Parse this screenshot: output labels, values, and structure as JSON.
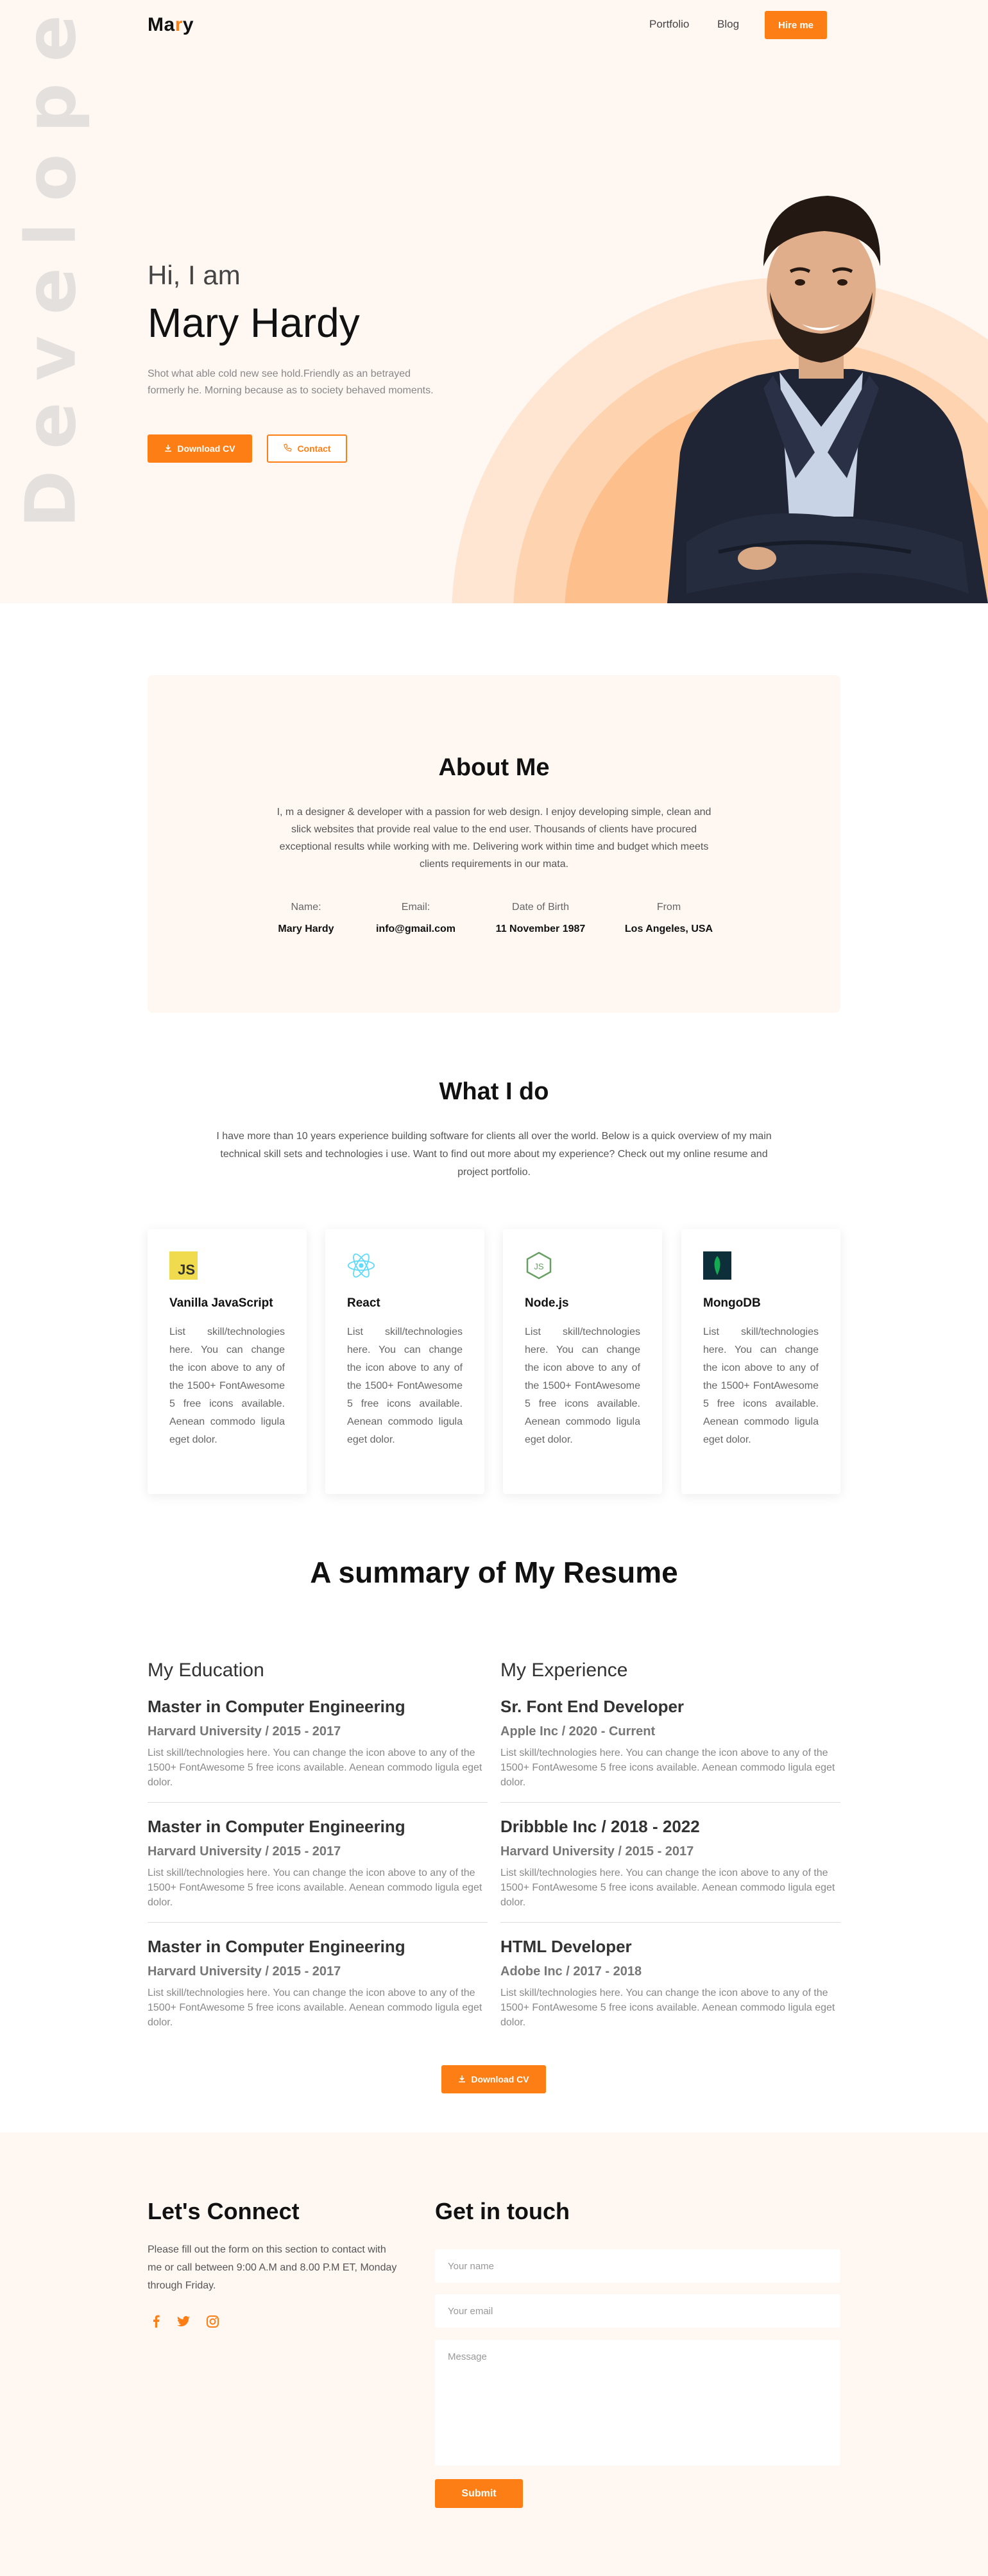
{
  "nav": {
    "logo_pre": "Ma",
    "logo_accent": "r",
    "logo_post": "y",
    "links": [
      "Portfolio",
      "Blog"
    ],
    "hire_label": "Hire me"
  },
  "hero": {
    "vertical_word": "Developer",
    "greeting": "Hi, I am",
    "name": "Mary Hardy",
    "description": "Shot what able cold new see hold.Friendly as an betrayed formerly he. Morning because as to society behaved moments.",
    "download_label": "Download CV",
    "contact_label": "Contact"
  },
  "about": {
    "title": "About Me",
    "text": "I, m a designer & developer with a passion for web design. I enjoy developing simple, clean and slick websites that provide real value to the end user. Thousands of clients have procured exceptional results while working with me. Delivering work within time and budget which meets clients requirements in our mata.",
    "info": [
      {
        "label": "Name:",
        "value": "Mary Hardy"
      },
      {
        "label": "Email:",
        "value": "info@gmail.com"
      },
      {
        "label": "Date of Birth",
        "value": "11 November 1987"
      },
      {
        "label": "From",
        "value": "Los Angeles, USA"
      }
    ]
  },
  "what_i_do": {
    "title": "What I do",
    "text": "I have more than 10 years experience building software for clients all over the world. Below is a quick overview of my main technical skill sets and technologies i use. Want to find out more about my experience? Check out my online resume and project portfolio.",
    "skills": [
      {
        "name": "Vanilla JavaScript",
        "icon": "javascript-icon",
        "desc": "List skill/technologies here. You can change the icon above to any of the 1500+ FontAwesome 5 free icons available. Aenean commodo ligula eget dolor."
      },
      {
        "name": "React",
        "icon": "react-icon",
        "desc": "List skill/technologies here. You can change the icon above to any of the 1500+ FontAwesome 5 free icons available. Aenean commodo ligula eget dolor."
      },
      {
        "name": "Node.js",
        "icon": "nodejs-icon",
        "desc": "List skill/technologies here. You can change the icon above to any of the 1500+ FontAwesome 5 free icons available. Aenean commodo ligula eget dolor."
      },
      {
        "name": "MongoDB",
        "icon": "mongodb-icon",
        "desc": "List skill/technologies here. You can change the icon above to any of the 1500+ FontAwesome 5 free icons available. Aenean commodo ligula eget dolor."
      }
    ]
  },
  "resume": {
    "title": "A summary of My Resume",
    "education_title": "My Education",
    "experience_title": "My Experience",
    "education": [
      {
        "title": "Master in Computer Engineering",
        "sub": "Harvard University / 2015 - 2017",
        "desc": "List skill/technologies here. You can change the icon above to any of the 1500+ FontAwesome 5 free icons available. Aenean commodo ligula eget dolor."
      },
      {
        "title": "Master in Computer Engineering",
        "sub": "Harvard University / 2015 - 2017",
        "desc": "List skill/technologies here. You can change the icon above to any of the 1500+ FontAwesome 5 free icons available. Aenean commodo ligula eget dolor."
      },
      {
        "title": "Master in Computer Engineering",
        "sub": "Harvard University / 2015 - 2017",
        "desc": "List skill/technologies here. You can change the icon above to any of the 1500+ FontAwesome 5 free icons available. Aenean commodo ligula eget dolor."
      }
    ],
    "experience": [
      {
        "title": "Sr. Font End Developer",
        "sub": "Apple Inc / 2020 - Current",
        "desc": "List skill/technologies here. You can change the icon above to any of the 1500+ FontAwesome 5 free icons available. Aenean commodo ligula eget dolor."
      },
      {
        "title": "Dribbble Inc / 2018 - 2022",
        "sub": "Harvard University / 2015 - 2017",
        "desc": "List skill/technologies here. You can change the icon above to any of the 1500+ FontAwesome 5 free icons available. Aenean commodo ligula eget dolor."
      },
      {
        "title": "HTML Developer",
        "sub": "Adobe Inc / 2017 - 2018",
        "desc": "List skill/technologies here. You can change the icon above to any of the 1500+ FontAwesome 5 free icons available. Aenean commodo ligula eget dolor."
      }
    ],
    "download_label": "Download CV"
  },
  "contact": {
    "connect_title": "Let's Connect",
    "connect_text": "Please fill out the form on this section to contact with me or call between 9:00 A.M and 8.00 P.M ET, Monday through Friday.",
    "social": [
      "facebook-icon",
      "twitter-icon",
      "instagram-icon"
    ],
    "touch_title": "Get in touch",
    "name_placeholder": "Your name",
    "email_placeholder": "Your email",
    "message_placeholder": "Message",
    "submit_label": "Submit"
  },
  "colors": {
    "accent": "#fd7e14",
    "hero_bg": "#fef7f2"
  }
}
